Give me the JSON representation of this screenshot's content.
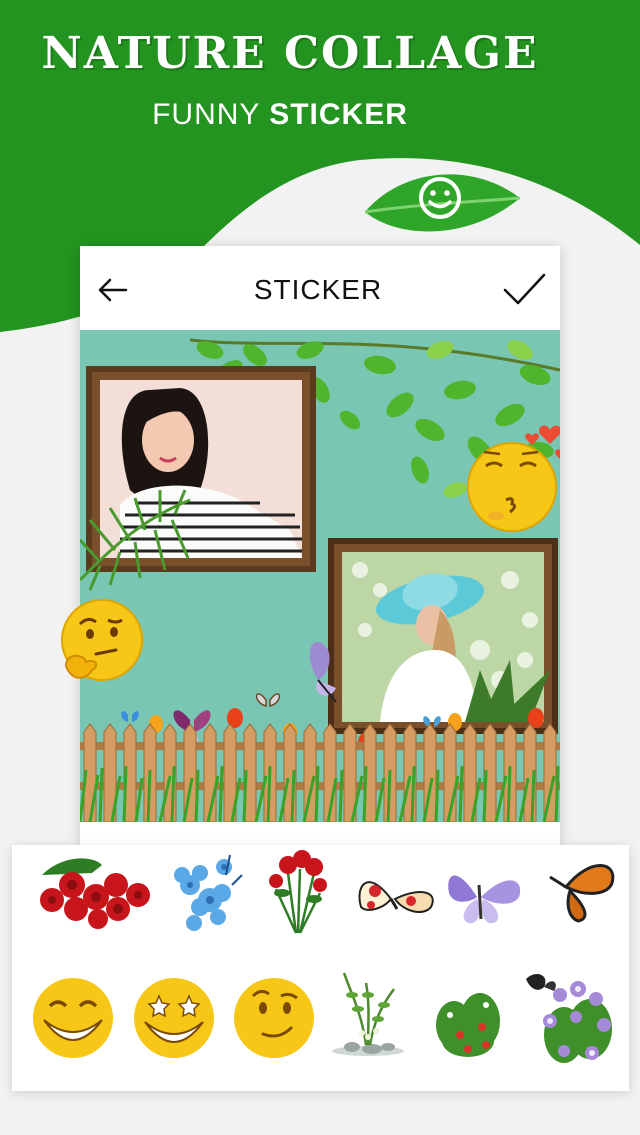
{
  "promo": {
    "title": "NATURE COLLAGE",
    "subtitle_light": "FUNNY ",
    "subtitle_bold": "STICKER"
  },
  "colors": {
    "brand_green": "#23941f",
    "canvas_teal": "#79c6b3",
    "emoji_yellow": "#f7c718"
  },
  "toolbar": {
    "back_icon": "arrow-left-icon",
    "title": "STICKER",
    "confirm_icon": "checkmark-icon"
  },
  "canvas_stickers": [
    "leaf-branch",
    "photo-frame-girl",
    "photo-frame-hat-woman",
    "kiss-emoji",
    "thinking-emoji",
    "butterfly",
    "wooden-fence",
    "grass",
    "tulips",
    "hearts"
  ],
  "sticker_tray": {
    "row1": [
      "roses-sticker",
      "blue-flowers-sticker",
      "rose-bouquet-sticker",
      "red-butterfly-sticker",
      "purple-butterfly-sticker",
      "monarch-butterfly-sticker"
    ],
    "row2": [
      "smile-emoji-sticker",
      "star-eyes-emoji-sticker",
      "raised-eyebrow-emoji-sticker",
      "fern-plant-sticker",
      "red-flower-bush-sticker",
      "purple-flowers-butterfly-sticker"
    ]
  }
}
